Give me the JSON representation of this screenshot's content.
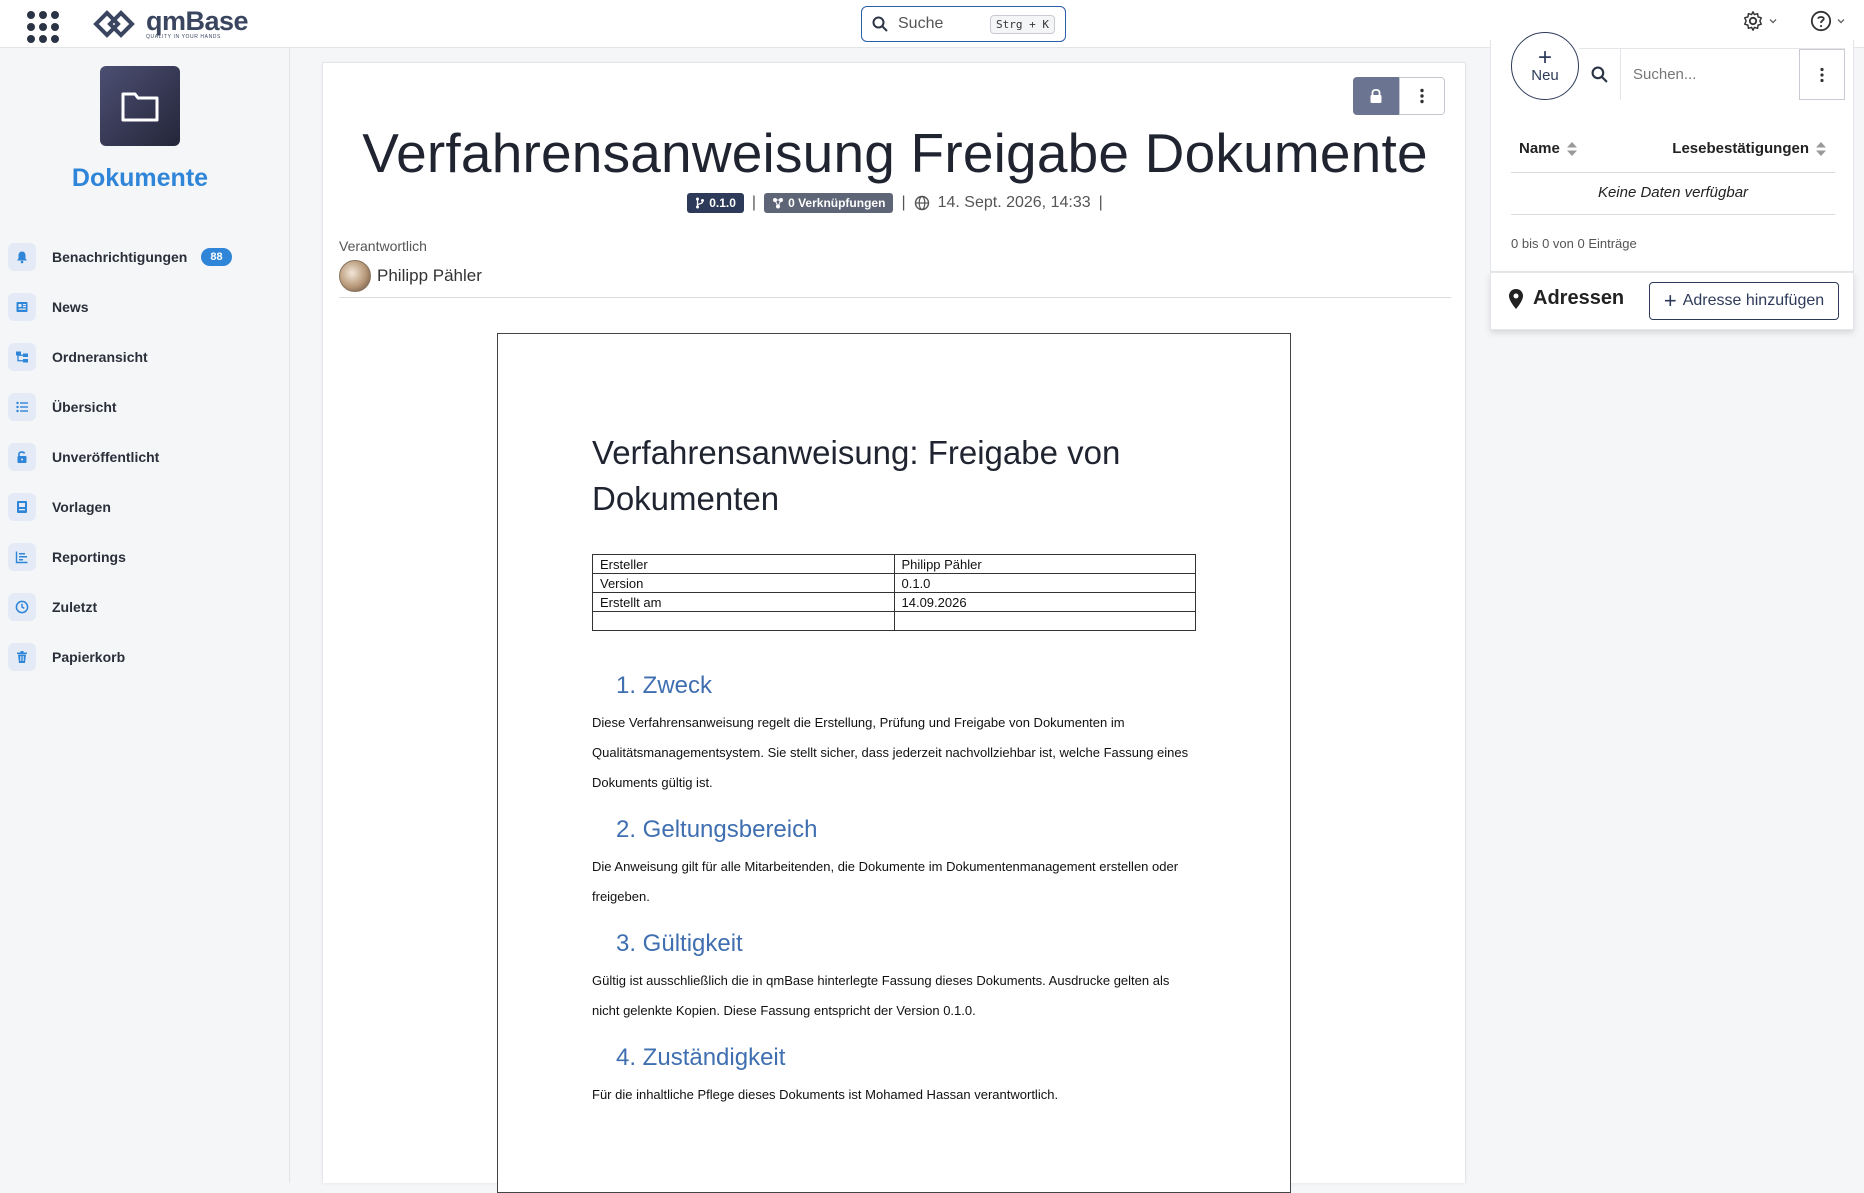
{
  "topbar": {
    "logo_name": "qmBase",
    "logo_tagline": "QUALITY IN YOUR HANDS",
    "search_label": "Suche",
    "search_shortcut": "Strg + K"
  },
  "sidebar": {
    "section_title": "Dokumente",
    "items": [
      {
        "label": "Benachrichtigungen",
        "icon": "bell-icon",
        "badge": "88"
      },
      {
        "label": "News",
        "icon": "newspaper-icon"
      },
      {
        "label": "Ordneransicht",
        "icon": "folder-tree-icon"
      },
      {
        "label": "Übersicht",
        "icon": "list-icon"
      },
      {
        "label": "Unveröffentlicht",
        "icon": "unlock-icon"
      },
      {
        "label": "Vorlagen",
        "icon": "template-icon"
      },
      {
        "label": "Reportings",
        "icon": "chart-icon"
      },
      {
        "label": "Zuletzt",
        "icon": "clock-icon"
      },
      {
        "label": "Papierkorb",
        "icon": "trash-icon"
      }
    ]
  },
  "document": {
    "title": "Verfahrensanweisung Freigabe Dokumente",
    "version": "0.1.0",
    "links": "0 Verknüpfungen",
    "date": "14. Sept. 2026, 14:33",
    "responsible_label": "Verantwortlich",
    "responsible_name": "Philipp Pähler",
    "page": {
      "heading": "Verfahrensanweisung: Freigabe von Dokumenten",
      "meta": [
        {
          "key": "Ersteller",
          "value": "Philipp Pähler"
        },
        {
          "key": "Version",
          "value": "0.1.0"
        },
        {
          "key": "Erstellt am",
          "value": "14.09.2026"
        },
        {
          "key": "",
          "value": ""
        }
      ],
      "sections": [
        {
          "heading": "1. Zweck",
          "text": "Diese Verfahrensanweisung regelt die Erstellung, Prüfung und Freigabe von Dokumenten im Qualitätsmanagementsystem. Sie stellt sicher, dass jederzeit nachvollziehbar ist, welche Fassung eines Dokuments gültig ist."
        },
        {
          "heading": "2. Geltungsbereich",
          "text": "Die Anweisung gilt für alle Mitarbeitenden, die Dokumente im Dokumentenmanagement erstellen oder freigeben."
        },
        {
          "heading": "3. Gültigkeit",
          "text": "Gültig ist ausschließlich die in qmBase hinterlegte Fassung dieses Dokuments. Ausdrucke gelten als nicht gelenkte Kopien. Diese Fassung entspricht der Version 0.1.0."
        },
        {
          "heading": "4. Zuständigkeit",
          "text": "Für die inhaltliche Pflege dieses Dokuments ist Mohamed Hassan verantwortlich."
        }
      ]
    }
  },
  "right_panel": {
    "new_label": "Neu",
    "search_placeholder": "Suchen...",
    "col_name": "Name",
    "col_confirmations": "Lesebestätigungen",
    "no_data": "Keine Daten verfügbar",
    "count": "0 bis 0 von 0 Einträge",
    "addresses_title": "Adressen",
    "add_address_label": "Adresse hinzufügen"
  },
  "colors": {
    "accent": "#2f85d8",
    "dark": "#2d3a59",
    "heading_blue": "#3f6fb0"
  }
}
